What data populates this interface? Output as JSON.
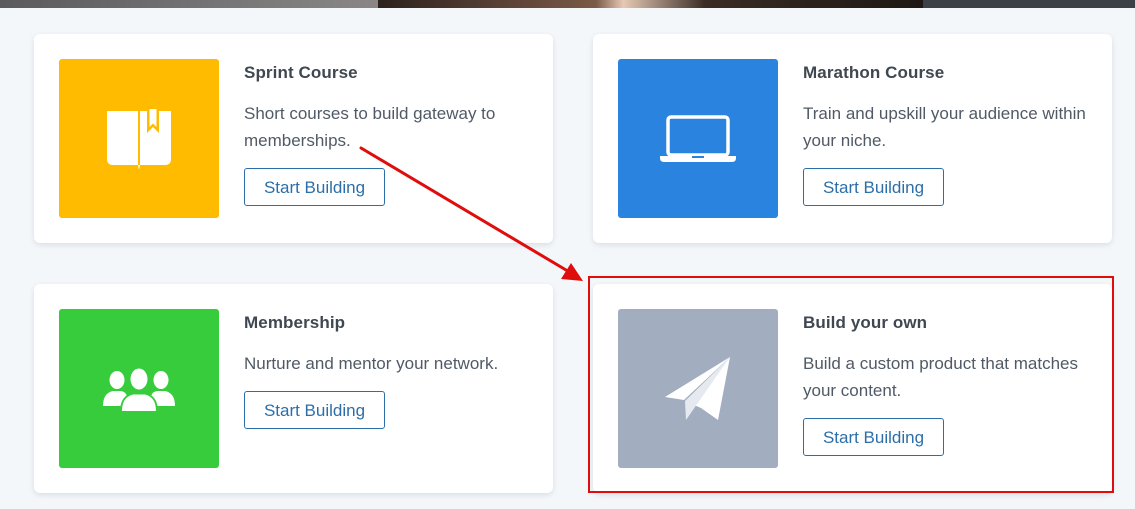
{
  "cards": [
    {
      "title": "Sprint Course",
      "description": "Short courses to build gateway to memberships.",
      "button_label": "Start Building",
      "icon": "book-icon",
      "tile_color": "#ffbb00"
    },
    {
      "title": "Marathon Course",
      "description": "Train and upskill your audience within your niche.",
      "button_label": "Start Building",
      "icon": "laptop-icon",
      "tile_color": "#2a83df"
    },
    {
      "title": "Membership",
      "description": "Nurture and mentor your network.",
      "button_label": "Start Building",
      "icon": "users-icon",
      "tile_color": "#36cc3c"
    },
    {
      "title": "Build your own",
      "description": "Build a custom product that matches your content.",
      "button_label": "Start Building",
      "icon": "paper-plane-icon",
      "tile_color": "#a2aebf"
    }
  ],
  "annotation": {
    "color": "#e00d0d",
    "highlighted_card": "Build your own"
  },
  "colors": {
    "background": "#f4f7fa",
    "card": "#ffffff",
    "button_border": "#2c6fa8",
    "title_text": "#3f4751",
    "body_text": "#505a66"
  }
}
